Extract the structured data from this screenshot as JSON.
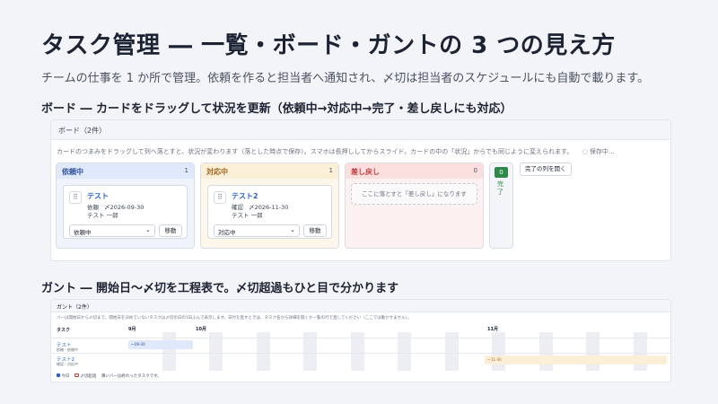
{
  "title": "タスク管理 ― 一覧・ボード・ガントの 3 つの見え方",
  "subtitle": "チームの仕事を 1 か所で管理。依頼を作ると担当者へ通知され、〆切は担当者のスケジュールにも自動で載ります。",
  "board_section": {
    "heading": "ボード ― カードをドラッグして状況を更新（依頼中→対応中→完了・差し戻しにも対応）",
    "panel_title": "ボード（2件）",
    "hint": "カードのつまみをドラッグして列へ落とすと、状況が変わります（落とした時点で保存）。スマホは長押ししてからスライド。カードの中の「状況」からでも同じように変えられます。",
    "saving": "◌ 保存中…",
    "columns": [
      {
        "label": "依頼中",
        "count": "1",
        "card": {
          "title": "テスト",
          "status": "依頼",
          "due": "〆2026-09-30",
          "assignee": "テスト 一郎",
          "select": "依頼中",
          "move": "移動"
        }
      },
      {
        "label": "対応中",
        "count": "1",
        "card": {
          "title": "テスト2",
          "status": "確認",
          "due": "〆2026-11-30",
          "assignee": "テスト 一郎",
          "select": "対応中",
          "move": "移動"
        }
      },
      {
        "label": "差し戻し",
        "count": "0",
        "drop": "ここに落とすと「差し戻し」になります"
      }
    ],
    "done": {
      "count": "0",
      "label": "完了",
      "open_button": "完了の列を開く"
    }
  },
  "gantt_section": {
    "heading": "ガント ― 開始日〜〆切を工程表で。〆切超過もひと目で分かります",
    "panel_title": "ガント（2件）",
    "hint": "バーは開始日から〆切まで。開始日を決めていないタスクは〆切の日の1日ぶんで表示します。日付を直すときは、タスク名から詳細を開くか一覧の行で直してください（ここでは動かせません）。",
    "task_header": "タスク",
    "months": [
      "9月",
      "10月",
      "11月"
    ],
    "tasks": [
      {
        "name": "テスト",
        "meta": "依頼・依頼中",
        "bar_label": "〜09-30"
      },
      {
        "name": "テスト2",
        "meta": "確認・対応中",
        "bar_label": "〜11-30"
      }
    ],
    "legend": {
      "today": "今日",
      "overdue": "〆切超過",
      "note": "薄いバーは終わったタスクです。"
    }
  },
  "colors": {
    "requested": "#dfe9fb",
    "in_progress": "#fbefd8",
    "rejected": "#fbdede",
    "done": "#2f8a4a",
    "link": "#2d5fd0",
    "weekend": "#eceef4"
  }
}
